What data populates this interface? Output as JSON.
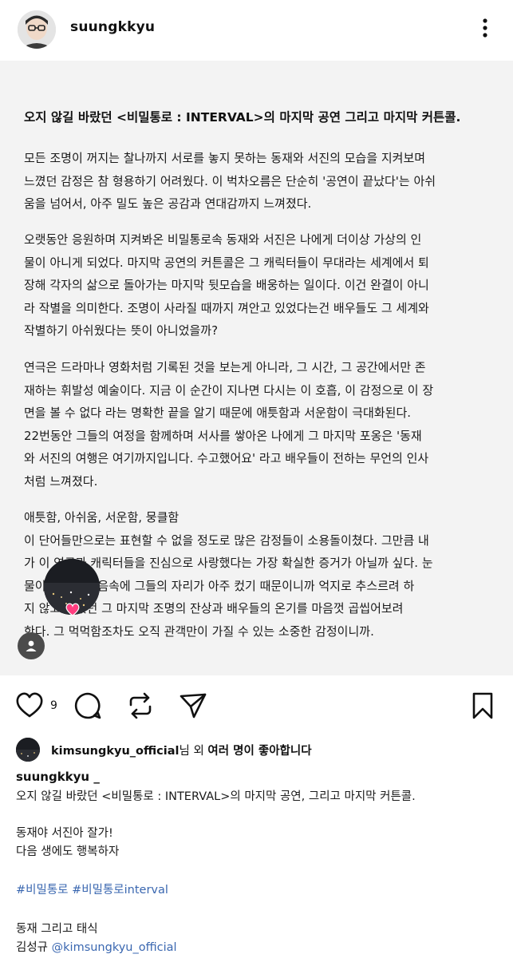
{
  "header": {
    "username": "suungkkyu"
  },
  "post": {
    "title": "오지 않길 바랐던 <비밀통로 : INTERVAL>의 마지막 공연 그리고 마지막 커튼콜.",
    "paragraphs": [
      [
        "모든 조명이 꺼지는 찰나까지 서로를 놓지 못하는 동재와 서진의 모습을 지켜보며",
        "느꼈던 감정은 참 형용하기 어려웠다. 이 벅차오름은 단순히 '공연이 끝났다'는 아쉬",
        "움을 넘어서, 아주 밀도 높은 공감과 연대감까지 느껴졌다."
      ],
      [
        "오랫동안 응원하며 지켜봐온 비밀통로속 동재와 서진은 나에게 더이상 가상의 인",
        "물이 아니게 되었다. 마지막 공연의 커튼콜은 그 캐릭터들이 무대라는 세계에서 퇴",
        "장해 각자의 삶으로 돌아가는 마지막 뒷모습을 배웅하는 일이다. 이건 완결이 아니",
        "라 작별을 의미한다. 조명이 사라질 때까지 껴안고 있었다는건 배우들도 그 세계와",
        "작별하기 아쉬웠다는 뜻이 아니었을까?"
      ],
      [
        "연극은 드라마나 영화처럼 기록된 것을 보는게 아니라, 그 시간, 그 공간에서만 존",
        "재하는 휘발성 예술이다. 지금 이 순간이 지나면 다시는 이 호흡, 이 감정으로 이 장",
        "면을 볼 수 없다 라는 명확한 끝을 알기 때문에 애틋함과 서운함이 극대화된다.",
        "22번동안 그들의 여정을 함께하며 서사를 쌓아온 나에게 그 마지막 포옹은 '동재",
        "와 서진의 여행은 여기까지입니다. 수고했어요' 라고 배우들이 전하는 무언의 인사",
        "처럼 느껴졌다."
      ],
      [
        "애틋함, 아쉬움, 서운함, 뭉클함",
        "이 단어들만으로는 표현할 수 없을 정도로 많은 감정들이 소용돌이쳤다. 그만큼 내",
        "가 이 연극과 캐릭터들을 진심으로 사랑했다는 가장 확실한 증거가 아닐까 싶다. 눈",
        "물이 나는건 마음속에 그들의 자리가 아주 컸기 때문이니까 억지로 추스르려 하",
        "지 않고 보았던 그 마지막 조명의 잔상과 배우들의 온기를 마음껏 곱씹어보려",
        "한다. 그 먹먹함조차도 오직 관객만이 가질 수 있는 소중한 감정이니까."
      ]
    ]
  },
  "actions": {
    "like_count": "9"
  },
  "liked_by": {
    "user": "kimsungkyu_official",
    "suffix": "님 외 ",
    "others": "여러 명이 좋아합니다"
  },
  "caption": {
    "username": "suungkkyu _",
    "line1": "오지 않길 바랐던 <비밀통로 : INTERVAL>의 마지막 공연, 그리고 마지막 커튼콜.",
    "line2": "동재야 서진아 잘가!",
    "line3": "다음 생에도 행복하자",
    "hashtags": "#비밀통로 #비밀통로interval",
    "line4": "동재 그리고 태식",
    "line5_prefix": "김성규 ",
    "mention": "@kimsungkyu_official"
  },
  "colors": {
    "card_bg": "#f3f3f3",
    "hashtag": "#3a67b0",
    "heart_badge": "#ff3d7f"
  }
}
